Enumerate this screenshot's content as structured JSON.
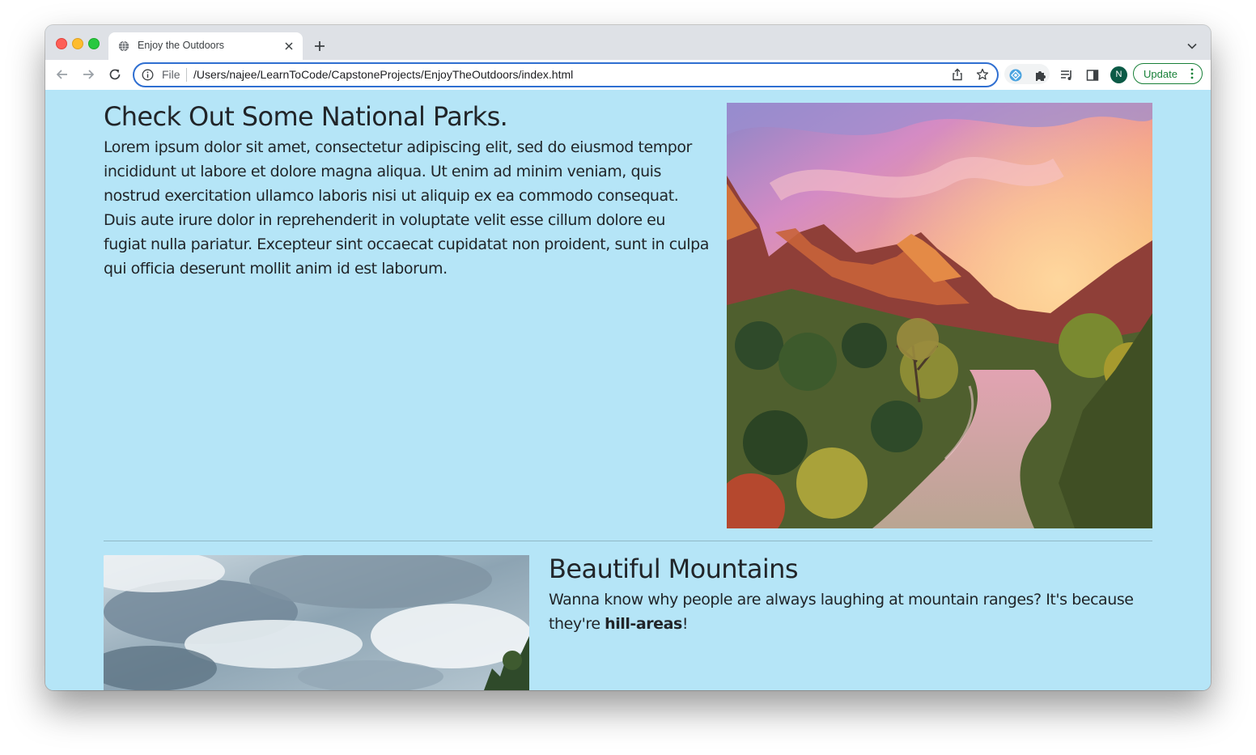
{
  "browser": {
    "tab_title": "Enjoy the Outdoors",
    "address_scheme": "File",
    "address_url": "/Users/najee/LearnToCode/CapstoneProjects/EnjoyTheOutdoors/index.html",
    "profile_initial": "N",
    "update_label": "Update",
    "accent_color": "#2f6fd1",
    "update_color": "#188038"
  },
  "icons": {
    "tab_favicon": "globe-icon",
    "tab_close": "close-icon",
    "new_tab": "plus-icon",
    "tab_search": "chevron-down-icon",
    "back": "arrow-left-icon",
    "forward": "arrow-right-icon",
    "reload": "reload-icon",
    "site_info": "info-icon",
    "share": "share-icon",
    "bookmark": "star-icon",
    "extension_1": "extension-badge-icon",
    "extensions": "puzzle-icon",
    "media": "playlist-icon",
    "side_panel": "side-panel-icon",
    "menu": "three-dots-icon"
  },
  "page": {
    "background_color": "#b5e5f7",
    "parks": {
      "heading": "Check Out Some National Parks.",
      "body": "Lorem ipsum dolor sit amet, consectetur adipiscing elit, sed do eiusmod tempor incididunt ut labore et dolore magna aliqua. Ut enim ad minim veniam, quis nostrud exercitation ullamco laboris nisi ut aliquip ex ea commodo consequat. Duis aute irure dolor in reprehenderit in voluptate velit esse cillum dolore eu fugiat nulla pariatur. Excepteur sint occaecat cupidatat non proident, sunt in culpa qui officia deserunt mollit anim id est laborum."
    },
    "mountains": {
      "heading": "Beautiful Mountains",
      "body_before": "Wanna know why people are always laughing at mountain ranges? It's because they're ",
      "body_bold": "hill-areas",
      "body_after": "!"
    }
  }
}
